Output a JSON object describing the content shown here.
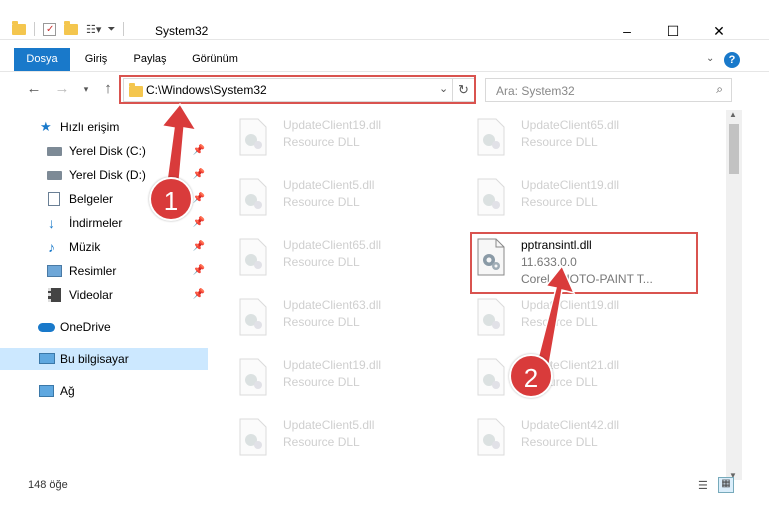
{
  "window": {
    "title": "System32",
    "minimize_glyph": "–",
    "maximize_glyph": "☐",
    "close_glyph": "✕"
  },
  "ribbon": {
    "tabs": [
      "Dosya",
      "Giriş",
      "Paylaş",
      "Görünüm"
    ],
    "active_tab": "Dosya",
    "help_label": "?",
    "accent": "#1979ca"
  },
  "address": {
    "path": "C:\\Windows\\System32",
    "search_placeholder": "Ara: System32"
  },
  "sidebar": {
    "quick_access": "Hızlı erişim",
    "items": [
      {
        "label": "Yerel Disk (C:)",
        "icon": "drive-icon",
        "pinned": true
      },
      {
        "label": "Yerel Disk (D:)",
        "icon": "drive-icon",
        "pinned": true
      },
      {
        "label": "Belgeler",
        "icon": "documents-icon",
        "pinned": true
      },
      {
        "label": "İndirmeler",
        "icon": "download-icon",
        "pinned": true
      },
      {
        "label": "Müzik",
        "icon": "music-icon",
        "pinned": true
      },
      {
        "label": "Resimler",
        "icon": "pictures-icon",
        "pinned": true
      },
      {
        "label": "Videolar",
        "icon": "videos-icon",
        "pinned": true
      }
    ],
    "onedrive": "OneDrive",
    "this_pc": "Bu bilgisayar",
    "network": "Ağ"
  },
  "files": {
    "left_column": [
      {
        "name": "UpdateClient19.dll",
        "desc": "Resource DLL"
      },
      {
        "name": "UpdateClient5.dll",
        "desc": "Resource DLL"
      },
      {
        "name": "UpdateClient65.dll",
        "desc": "Resource DLL"
      },
      {
        "name": "UpdateClient63.dll",
        "desc": "Resource DLL"
      },
      {
        "name": "UpdateClient19.dll",
        "desc": "Resource DLL"
      },
      {
        "name": "UpdateClient5.dll",
        "desc": "Resource DLL"
      }
    ],
    "right_column": [
      {
        "name": "UpdateClient65.dll",
        "desc": "Resource DLL"
      },
      {
        "name": "UpdateClient19.dll",
        "desc": "Resource DLL"
      },
      {
        "name": "pptransintl.dll",
        "version": "11.633.0.0",
        "desc": "Corel PHOTO-PAINT T...",
        "active": true
      },
      {
        "name": "UpdateClient19.dll",
        "desc": "Resource DLL"
      },
      {
        "name": "UpdateClient21.dll",
        "desc": "Resource DLL"
      },
      {
        "name": "UpdateClient42.dll",
        "desc": "Resource DLL"
      }
    ]
  },
  "status": {
    "item_count": "148 öğe"
  },
  "callouts": [
    "1",
    "2"
  ],
  "highlight_color": "#d9534f"
}
